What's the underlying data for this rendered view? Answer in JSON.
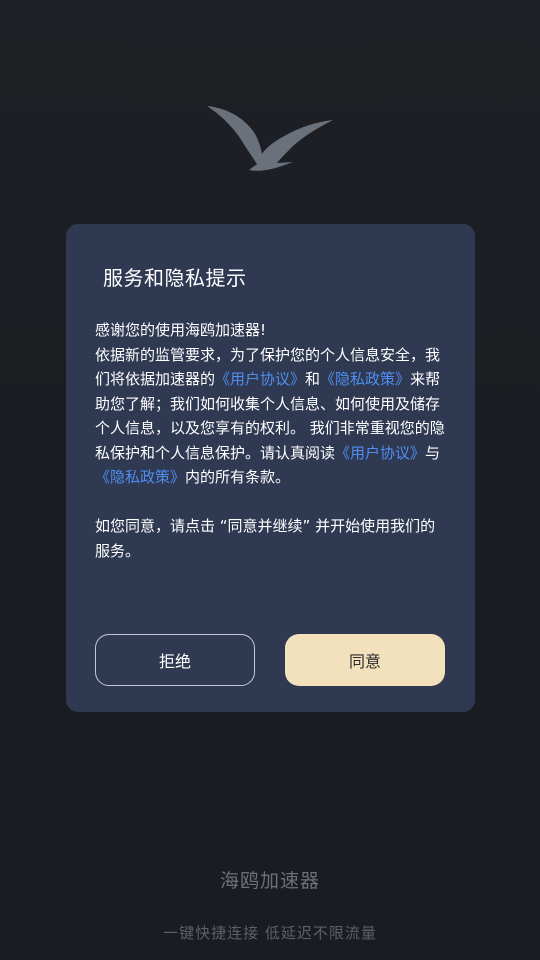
{
  "logo": {
    "icon": "seagull-icon",
    "color": "#6b717a"
  },
  "dialog": {
    "title": "服务和隐私提示",
    "line1": "感谢您的使用海鸥加速器!",
    "p1_a": "依据新的监管要求，为了保护您的个人信息安全，我们将依据加速器的",
    "user_agreement_link": "《用户协议》",
    "p1_b": "和",
    "privacy_policy_link": "《隐私政策》",
    "p1_c": "来帮助您了解；我们如何收集个人信息、如何使用及储存个人信息，以及您享有的权利。 我们非常重视您的隐私保护和个人信息保护。请认真阅读",
    "user_agreement_link_2": "《用户协议》",
    "p1_d": "与",
    "privacy_policy_link_2": "《隐私政策》",
    "p1_e": "内的所有条款。",
    "p2": "如您同意，请点击 “同意并继续” 并开始使用我们的服务。",
    "reject_label": "拒绝",
    "agree_label": "同意",
    "colors": {
      "background": "#2f3952",
      "link": "#4f8ef0",
      "agree_button": "#f3e1bd"
    }
  },
  "footer": {
    "app_name": "海鸥加速器",
    "tagline": "一键快捷连接 低延迟不限流量"
  }
}
